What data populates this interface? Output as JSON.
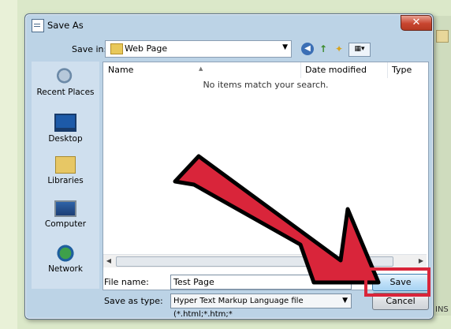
{
  "dialog": {
    "title": "Save As",
    "close_glyph": "✕",
    "save_in_label": "Save in:",
    "save_in_value": "Web Page",
    "toolbar": {
      "back_icon": "back-icon",
      "up_icon": "up-folder-icon",
      "new_folder_icon": "new-folder-icon",
      "views_icon": "views-menu-icon"
    },
    "places": [
      {
        "label": "Recent Places",
        "icon": "recent-places-icon"
      },
      {
        "label": "Desktop",
        "icon": "desktop-icon"
      },
      {
        "label": "Libraries",
        "icon": "libraries-icon"
      },
      {
        "label": "Computer",
        "icon": "computer-icon"
      },
      {
        "label": "Network",
        "icon": "network-icon"
      }
    ],
    "columns": [
      "Name",
      "Date modified",
      "Type"
    ],
    "empty_message": "No items match your search.",
    "file_name_label": "File name:",
    "file_name_value": "Test Page",
    "save_as_type_label": "Save as type:",
    "save_as_type_value": "Hyper Text Markup Language file (*.html;*.htm;*",
    "save_label": "Save",
    "cancel_label": "Cancel"
  },
  "background": {
    "status_text": "INS"
  },
  "colors": {
    "annotation_red": "#d9253a",
    "dialog_frame": "#bcd3e6"
  }
}
